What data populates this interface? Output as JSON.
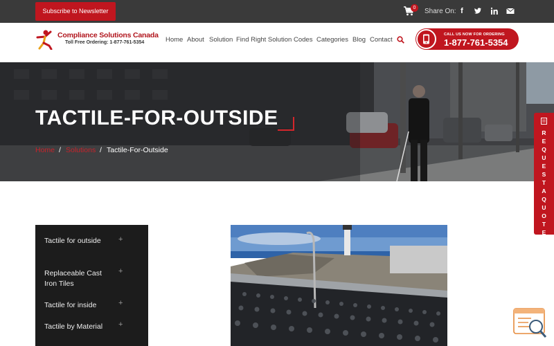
{
  "topbar": {
    "subscribe_label": "Subscribe to Newsletter",
    "cart_count": "0",
    "share_label": "Share On:",
    "social": [
      "facebook-icon",
      "twitter-icon",
      "linkedin-icon",
      "email-icon"
    ]
  },
  "header": {
    "logo_name": "Compliance Solutions Canada",
    "logo_sub": "Toll Free Ordering: 1-877-761-5354",
    "nav": [
      "Home",
      "About",
      "Solution",
      "Find Right Solution",
      "Codes",
      "Categories",
      "Blog",
      "Contact"
    ],
    "call_top": "CALL US NOW FOR ORDERING",
    "call_phone": "1-877-761-5354"
  },
  "hero": {
    "title": "TACTILE-FOR-OUTSIDE",
    "breadcrumb": [
      "Home",
      "Solutions",
      "Tactile-For-Outside"
    ],
    "separator": "/"
  },
  "sidebar": {
    "items": [
      {
        "label": "Tactile for outside"
      },
      {
        "label": "Replaceable Cast Iron Tiles"
      },
      {
        "label": "Tactile for inside"
      },
      {
        "label": "Tactile by Material"
      }
    ]
  },
  "quote_tab": {
    "letters": [
      "R",
      "E",
      "Q",
      "U",
      "E",
      "S",
      "T",
      "A",
      "Q",
      "U",
      "O",
      "T",
      "E"
    ]
  },
  "colors": {
    "brand_red": "#c0161f",
    "dark_bar": "#3a3a3a",
    "sidebar_bg": "#1c1c1c"
  }
}
